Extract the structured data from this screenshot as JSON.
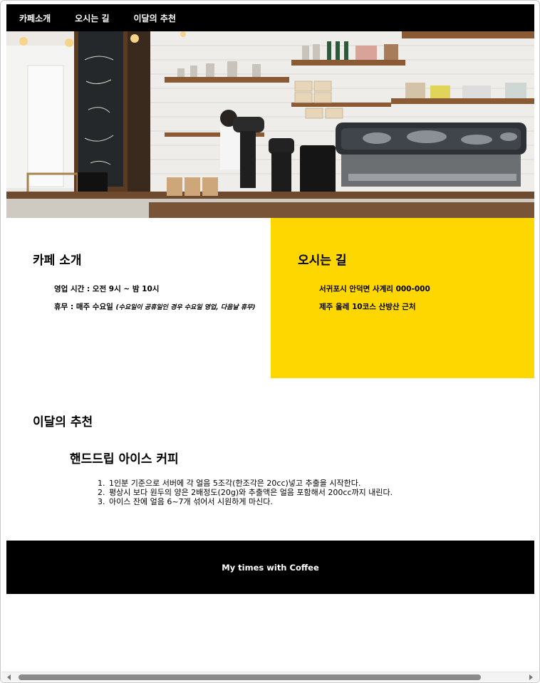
{
  "nav": {
    "items": [
      {
        "label": "카페소개"
      },
      {
        "label": "오시는 길"
      },
      {
        "label": "이달의 추천"
      }
    ]
  },
  "about": {
    "title": "카페 소개",
    "hours": "영업 시간 : 오전 9시 ~ 밤 10시",
    "holiday": "휴무 : 매주 수요일",
    "holiday_note": "(수요일이 공휴일인 경우 수요일 영업, 다음날 휴무)"
  },
  "directions": {
    "title": "오시는 길",
    "address": "서귀포시 안덕면 사계리 000-000",
    "landmark": "제주 올레 10코스 산방산 근처"
  },
  "recommendation": {
    "title": "이달의 추천",
    "menu_name": "핸드드립 아이스 커피",
    "steps": [
      "1인분 기준으로 서버에 각 얼음 5조각(한조각은 20cc)넣고 추출을 시작한다.",
      "평상시 보다 원두의 양은 2배정도(20g)와 추출액은 얼음 포함해서 200cc까지 내린다.",
      "아이스 잔에 얼음 6~7개 섞어서 시원하게 마신다."
    ]
  },
  "footer": {
    "text": "My times with Coffee"
  },
  "colors": {
    "nav_bg": "#000000",
    "directions_bg": "#FFD700",
    "footer_bg": "#000000"
  },
  "hero": {
    "image": "cafe-counter-photo"
  }
}
